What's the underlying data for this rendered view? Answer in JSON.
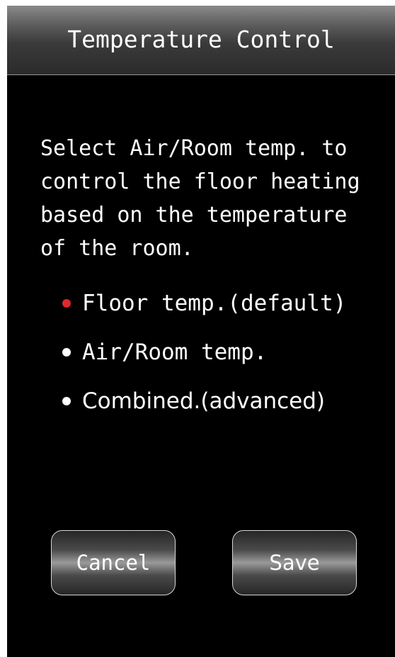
{
  "header": {
    "title": "Temperature Control"
  },
  "description": "Select Air/Room temp. to\ncontrol the floor heating\nbased on the temperature\nof the room.",
  "options": [
    {
      "label": "Floor temp.(default)",
      "selected": true
    },
    {
      "label": "Air/Room temp.",
      "selected": false
    },
    {
      "label": "Combined.(advanced)",
      "selected": false
    }
  ],
  "buttons": {
    "cancel_label": "Cancel",
    "save_label": "Save"
  },
  "colors": {
    "selected_bullet": "#e0282d",
    "background": "#000000",
    "text": "#ffffff"
  }
}
